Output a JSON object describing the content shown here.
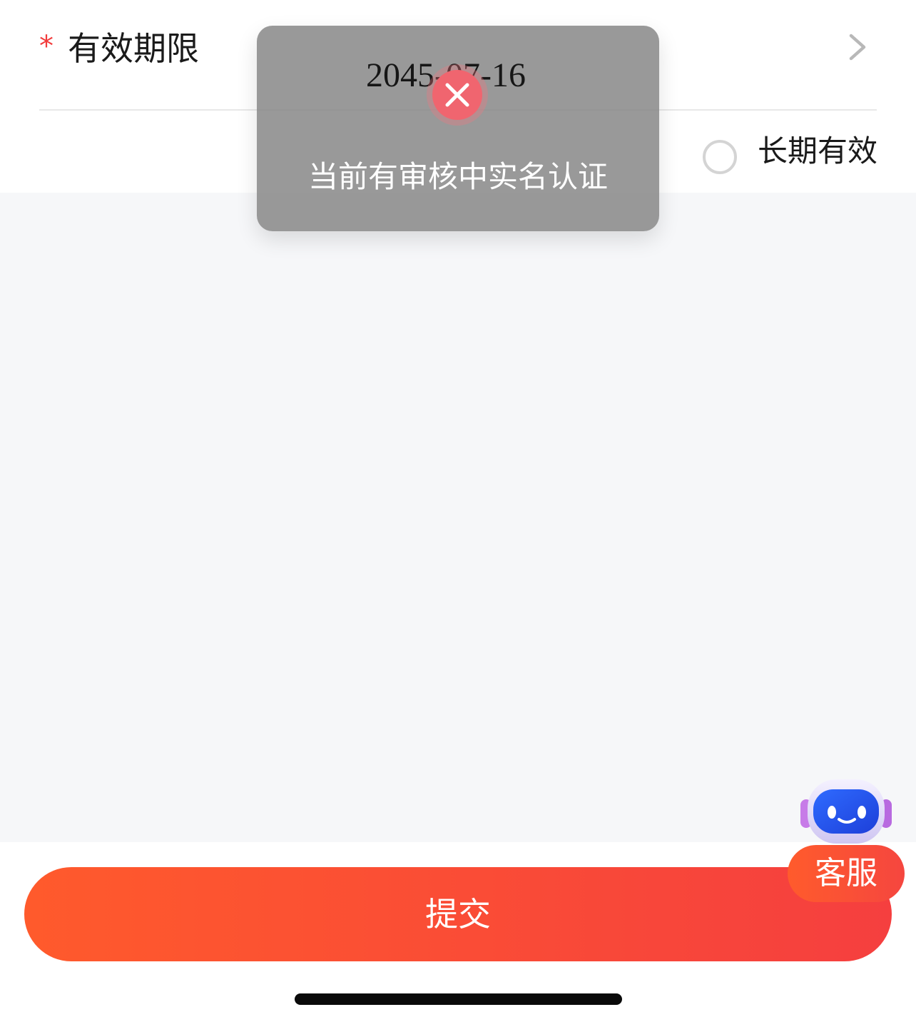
{
  "form": {
    "required_mark": "*",
    "expiry_label": "有效期限",
    "long_term_label": "长期有效"
  },
  "toast": {
    "date_value": "2045-07-16",
    "message": "当前有审核中实名认证"
  },
  "footer": {
    "submit_label": "提交"
  },
  "support": {
    "label": "客服"
  },
  "colors": {
    "accent": "#f5463f",
    "required": "#f23b3b"
  }
}
